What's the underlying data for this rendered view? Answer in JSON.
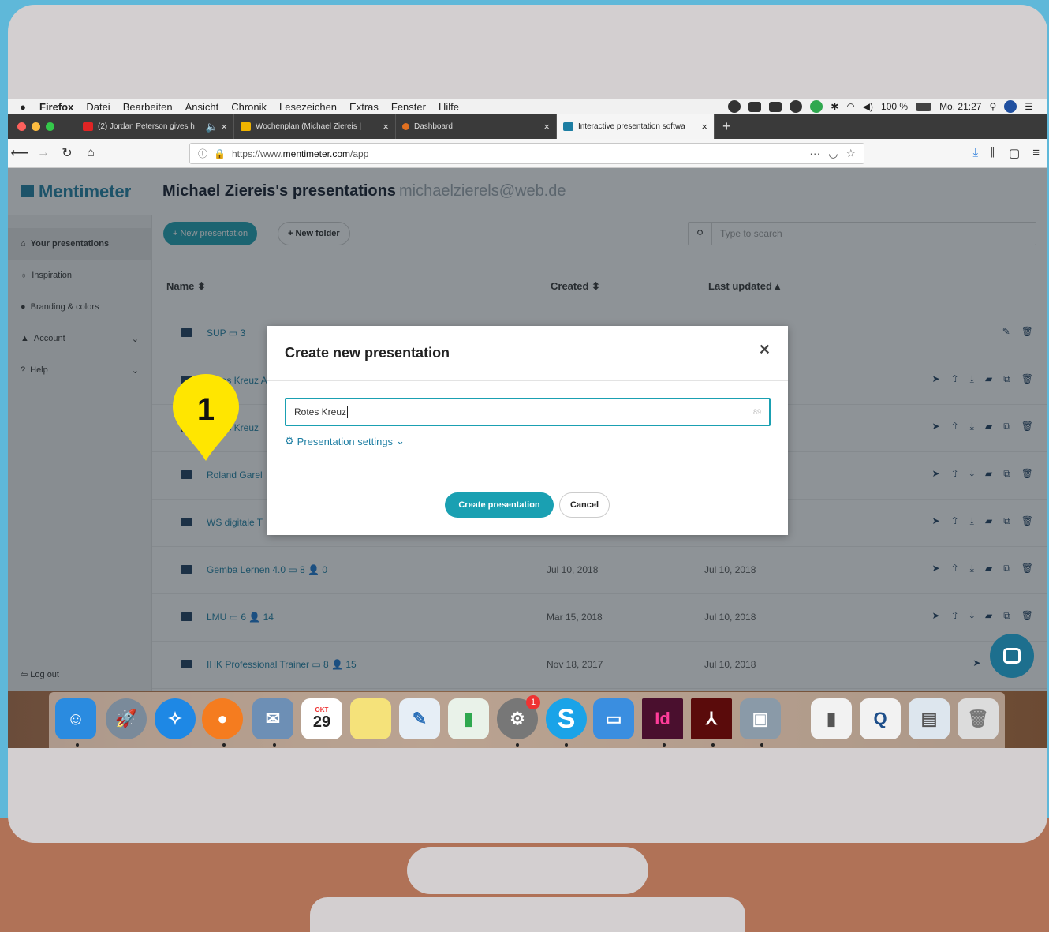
{
  "menubar": {
    "app": "Firefox",
    "items": [
      "Datei",
      "Bearbeiten",
      "Ansicht",
      "Chronik",
      "Lesezeichen",
      "Extras",
      "Fenster",
      "Hilfe"
    ],
    "battery": "100 %",
    "clock": "Mo. 21:27"
  },
  "tabs": [
    {
      "label": "(2) Jordan Peterson gives h",
      "fav_color": "#e02424"
    },
    {
      "label": "Wochenplan (Michael Ziereis | ",
      "fav_color": "#f0b400"
    },
    {
      "label": "Dashboard",
      "fav_color": "#e07020"
    },
    {
      "label": "Interactive presentation softwa",
      "fav_color": "#1d7ea3"
    }
  ],
  "urlbar": {
    "prefix": "https://www.",
    "host": "mentimeter.com",
    "path": "/app"
  },
  "app": {
    "logo": "Mentimeter",
    "title": "Michael Ziereis's presentations",
    "email": "michaelzierels@web.de",
    "sidebar": [
      "Your presentations",
      "Inspiration",
      "Branding & colors",
      "Account",
      "Help"
    ],
    "logout": "Log out",
    "new_presentation": "+ New presentation",
    "new_folder": "+ New folder",
    "search_placeholder": "Type to search",
    "columns": {
      "name": "Name ⬍",
      "created": "Created ⬍",
      "updated": "Last updated ▴"
    },
    "rows": [
      {
        "name": "SUP  ▭ 3",
        "created": "",
        "updated": ""
      },
      {
        "name": "Rotes Kreuz A",
        "created": "",
        "updated": ""
      },
      {
        "name": "Rotes Kreuz",
        "created": "",
        "updated": ""
      },
      {
        "name": "Roland Garel",
        "created": "",
        "updated": ""
      },
      {
        "name": "WS digitale T",
        "created": "",
        "updated": ""
      },
      {
        "name": "Gemba Lernen 4.0  ▭ 8  👤 0",
        "created": "Jul 10, 2018",
        "updated": "Jul 10, 2018"
      },
      {
        "name": "LMU  ▭ 6  👤 14",
        "created": "Mar 15, 2018",
        "updated": "Jul 10, 2018"
      },
      {
        "name": "IHK Professional Trainer  ▭ 8  👤 15",
        "created": "Nov 18, 2017",
        "updated": "Jul 10, 2018"
      }
    ]
  },
  "modal": {
    "title": "Create new presentation",
    "input_value": "Rotes Kreuz",
    "char_count": "89",
    "settings_link": "Presentation settings",
    "create_label": "Create presentation",
    "cancel_label": "Cancel"
  },
  "marker": {
    "number": "1",
    "color": "#ffe600"
  },
  "dock": {
    "calendar_month": "OKT",
    "calendar_day": "29",
    "badge": "1",
    "indesign": "Id"
  }
}
